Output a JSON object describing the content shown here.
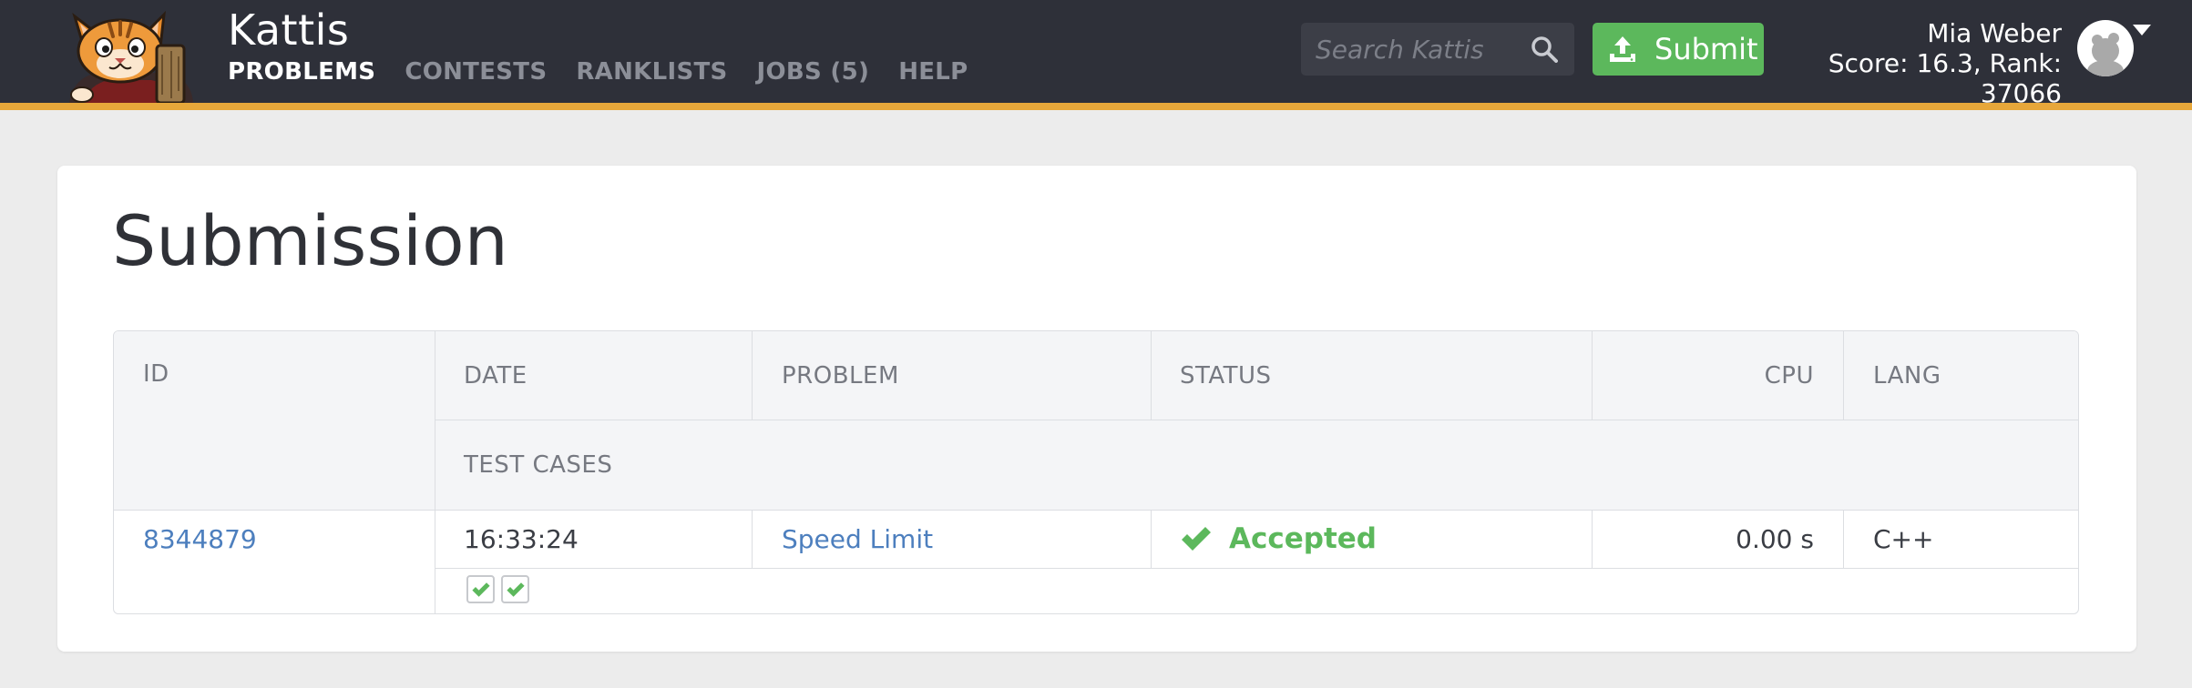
{
  "app": {
    "brand": "Kattis",
    "nav": [
      {
        "label": "PROBLEMS",
        "active": true
      },
      {
        "label": "CONTESTS",
        "active": false
      },
      {
        "label": "RANKLISTS",
        "active": false
      },
      {
        "label": "JOBS (5)",
        "active": false
      },
      {
        "label": "HELP",
        "active": false
      }
    ],
    "search_placeholder": "Search Kattis",
    "submit_label": "Submit",
    "user": {
      "name": "Mia Weber",
      "score_rank": "Score: 16.3, Rank: 37066"
    }
  },
  "page": {
    "title": "Submission"
  },
  "table": {
    "headers": {
      "id": "ID",
      "date": "DATE",
      "problem": "PROBLEM",
      "status": "STATUS",
      "cpu": "CPU",
      "lang": "LANG",
      "test_cases": "TEST CASES"
    },
    "row": {
      "id": "8344879",
      "date": "16:33:24",
      "problem": "Speed Limit",
      "status": "Accepted",
      "cpu": "0.00 s",
      "lang": "C++",
      "test_cases": [
        "accepted",
        "accepted"
      ]
    }
  },
  "colors": {
    "topbar": "#2e3039",
    "accent_stripe": "#e7a73a",
    "success": "#5cb85c",
    "link": "#4d7fbe"
  },
  "icons": {
    "logo": "kattis-cat-logo",
    "search": "search-icon",
    "upload": "upload-icon",
    "avatar": "user-avatar",
    "status": "checkmark-icon"
  }
}
